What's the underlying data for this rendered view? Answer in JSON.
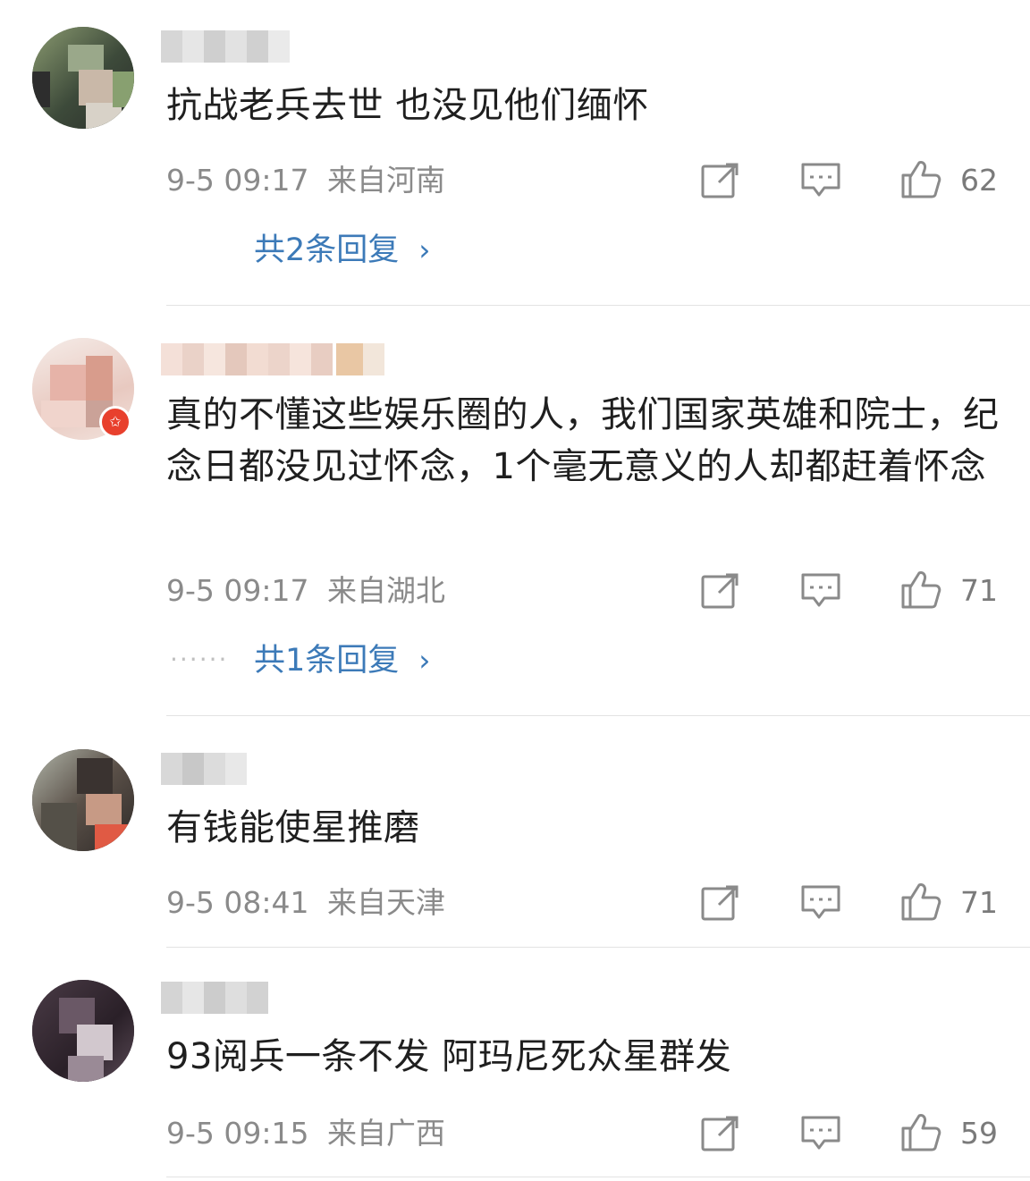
{
  "comments": [
    {
      "text": "抗战老兵去世 也没见他们缅怀",
      "time": "9-5 09:17",
      "location": "来自河南",
      "likes": "62",
      "replies": "共2条回复",
      "has_dots": false
    },
    {
      "text": "真的不懂这些娱乐圈的人，我们国家英雄和院士，纪念日都没见过怀念，1个毫无意义的人却都赶着怀念",
      "time": "9-5 09:17",
      "location": "来自湖北",
      "likes": "71",
      "replies": "共1条回复",
      "has_dots": true,
      "dots": "······",
      "badge": "✩"
    },
    {
      "text": "有钱能使星推磨",
      "time": "9-5 08:41",
      "location": "来自天津",
      "likes": "71"
    },
    {
      "text": "93阅兵一条不发 阿玛尼死众星群发",
      "time": "9-5 09:15",
      "location": "来自广西",
      "likes": "59"
    }
  ],
  "icons": {
    "repost": "share-edit-icon",
    "comment": "comment-icon",
    "like": "thumbs-up-icon",
    "reply_chevron": "chevron-right-icon"
  },
  "colors": {
    "reply_link": "#3c7ab8",
    "meta_text": "#8a8a8a",
    "badge": "#e8402d"
  }
}
